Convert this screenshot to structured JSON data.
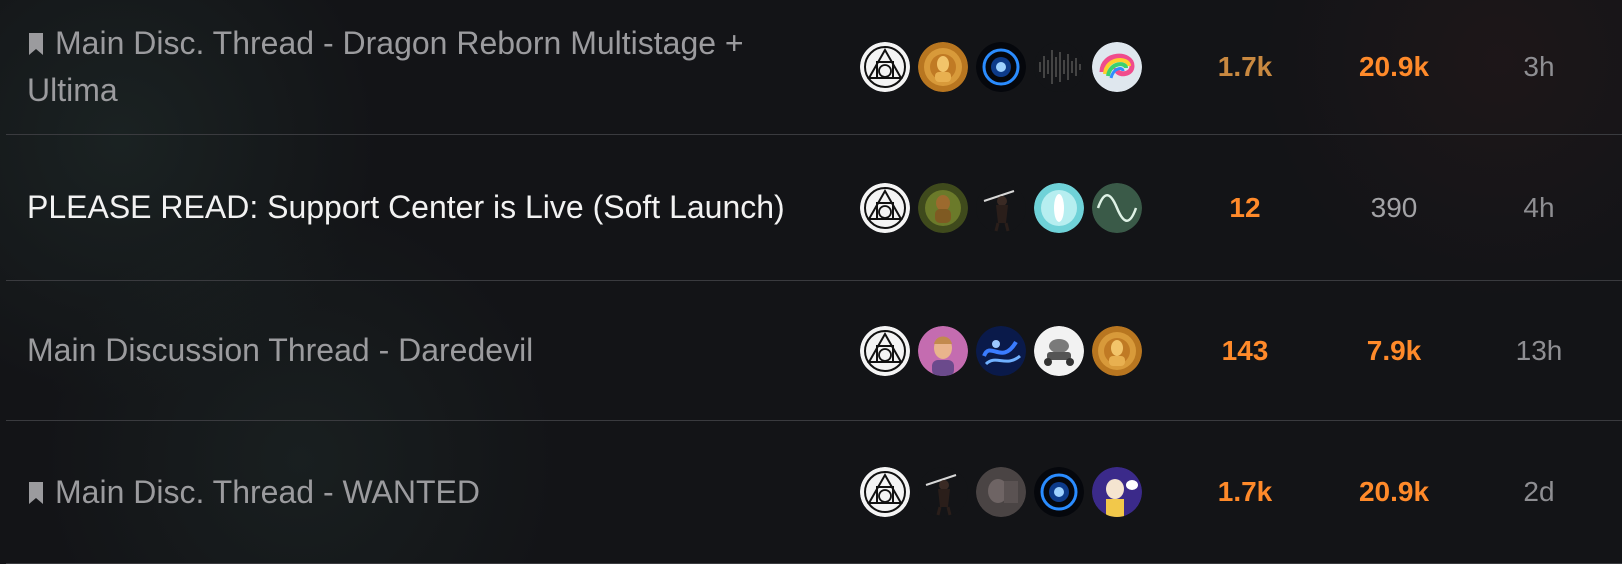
{
  "colors": {
    "background": "#131417",
    "title_read": "#9b9b9e",
    "title_unread": "#f2f2f2",
    "replies_hot": "#ff8a2a",
    "replies_warm": "#c98940",
    "views_hot": "#ff8a2a",
    "views_normal": "#a3a3a6",
    "activity": "#8e8e92",
    "divider": "#3a3b3f"
  },
  "topics": [
    {
      "title": "Main Disc. Thread - Dragon Reborn Multistage + Ultima",
      "bookmarked": true,
      "unread": false,
      "posters": [
        "alchemy-triangle-avatar",
        "golden-buddha-avatar",
        "blue-eye-avatar",
        "soundwave-avatar",
        "rainbow-swirl-avatar"
      ],
      "replies": "1.7k",
      "views": "20.9k",
      "activity": "3h"
    },
    {
      "title": "PLEASE READ: Support Center is Live (Soft Launch)",
      "bookmarked": false,
      "unread": true,
      "posters": [
        "alchemy-triangle-avatar",
        "green-figure-avatar",
        "dark-warrior-avatar",
        "white-light-avatar",
        "sine-wave-avatar"
      ],
      "replies": "12",
      "views": "390",
      "activity": "4h"
    },
    {
      "title": "Main Discussion Thread - Daredevil",
      "bookmarked": false,
      "unread": false,
      "posters": [
        "alchemy-triangle-avatar",
        "portrait-man-avatar",
        "blue-neon-avatar",
        "white-robot-avatar",
        "golden-buddha-avatar"
      ],
      "replies": "143",
      "views": "7.9k",
      "activity": "13h"
    },
    {
      "title": "Main Disc. Thread - WANTED",
      "bookmarked": true,
      "unread": false,
      "posters": [
        "alchemy-triangle-avatar",
        "dark-warrior-avatar",
        "grey-photo-avatar",
        "blue-eye-avatar",
        "bald-hero-avatar"
      ],
      "replies": "1.7k",
      "views": "20.9k",
      "activity": "2d"
    }
  ]
}
